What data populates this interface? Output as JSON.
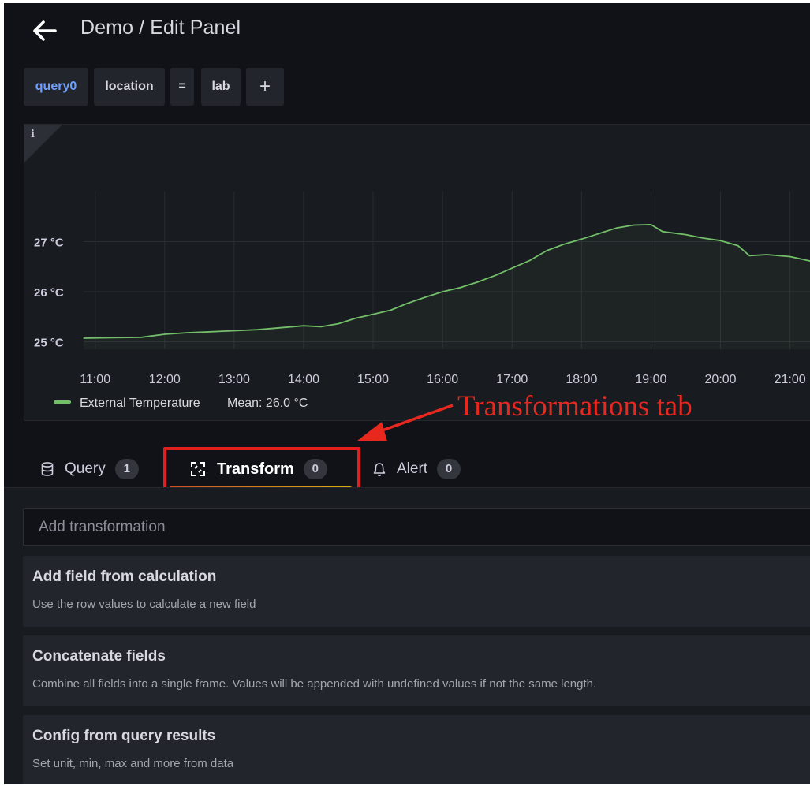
{
  "header": {
    "back_icon": "arrow-left-icon",
    "title": "Demo / Edit Panel"
  },
  "query_chips": {
    "query": "query0",
    "key": "location",
    "operator": "=",
    "value": "lab",
    "add": "+"
  },
  "panel": {
    "info_icon": "i"
  },
  "chart_data": {
    "type": "line",
    "title": "",
    "xlabel": "",
    "ylabel": "",
    "x_ticks": [
      "11:00",
      "12:00",
      "13:00",
      "14:00",
      "15:00",
      "16:00",
      "17:00",
      "18:00",
      "19:00",
      "20:00",
      "21:00"
    ],
    "y_ticks": [
      "25 °C",
      "26 °C",
      "27 °C"
    ],
    "y_tick_values": [
      25,
      26,
      27
    ],
    "ylim": [
      24.85,
      28.0
    ],
    "xlim": [
      "10:50",
      "21:20"
    ],
    "grid": true,
    "series": [
      {
        "name": "External Temperature",
        "color": "#73bf69",
        "points": [
          [
            "10:50",
            25.07
          ],
          [
            "11:15",
            25.08
          ],
          [
            "11:40",
            25.09
          ],
          [
            "12:00",
            25.15
          ],
          [
            "12:20",
            25.18
          ],
          [
            "12:40",
            25.2
          ],
          [
            "13:00",
            25.22
          ],
          [
            "13:20",
            25.24
          ],
          [
            "13:40",
            25.28
          ],
          [
            "14:00",
            25.32
          ],
          [
            "14:15",
            25.3
          ],
          [
            "14:30",
            25.36
          ],
          [
            "14:45",
            25.47
          ],
          [
            "15:00",
            25.55
          ],
          [
            "15:15",
            25.63
          ],
          [
            "15:30",
            25.77
          ],
          [
            "15:45",
            25.89
          ],
          [
            "16:00",
            26.0
          ],
          [
            "16:15",
            26.08
          ],
          [
            "16:30",
            26.19
          ],
          [
            "16:45",
            26.32
          ],
          [
            "17:00",
            26.47
          ],
          [
            "17:15",
            26.62
          ],
          [
            "17:30",
            26.82
          ],
          [
            "17:45",
            26.95
          ],
          [
            "18:00",
            27.05
          ],
          [
            "18:15",
            27.16
          ],
          [
            "18:30",
            27.27
          ],
          [
            "18:45",
            27.33
          ],
          [
            "19:00",
            27.34
          ],
          [
            "19:10",
            27.2
          ],
          [
            "19:30",
            27.14
          ],
          [
            "19:45",
            27.07
          ],
          [
            "20:00",
            27.02
          ],
          [
            "20:15",
            26.92
          ],
          [
            "20:25",
            26.72
          ],
          [
            "20:40",
            26.74
          ],
          [
            "21:00",
            26.7
          ],
          [
            "21:20",
            26.6
          ]
        ]
      }
    ],
    "legend": {
      "label": "External Temperature",
      "stat": "Mean: 26.0 °C",
      "placement": "bottom-left"
    }
  },
  "annotation": {
    "text": "Transformations tab",
    "color": "#e8271f"
  },
  "tabs": [
    {
      "label": "Query",
      "count": "1",
      "icon": "database-icon"
    },
    {
      "label": "Transform",
      "count": "0",
      "icon": "transform-icon",
      "active": true
    },
    {
      "label": "Alert",
      "count": "0",
      "icon": "bell-icon"
    }
  ],
  "editor": {
    "placeholder": "Add transformation",
    "transformations": [
      {
        "title": "Add field from calculation",
        "description": "Use the row values to calculate a new field"
      },
      {
        "title": "Concatenate fields",
        "description": "Combine all fields into a single frame. Values will be appended with undefined values if not the same length."
      },
      {
        "title": "Config from query results",
        "description": "Set unit, min, max and more from data"
      }
    ]
  }
}
